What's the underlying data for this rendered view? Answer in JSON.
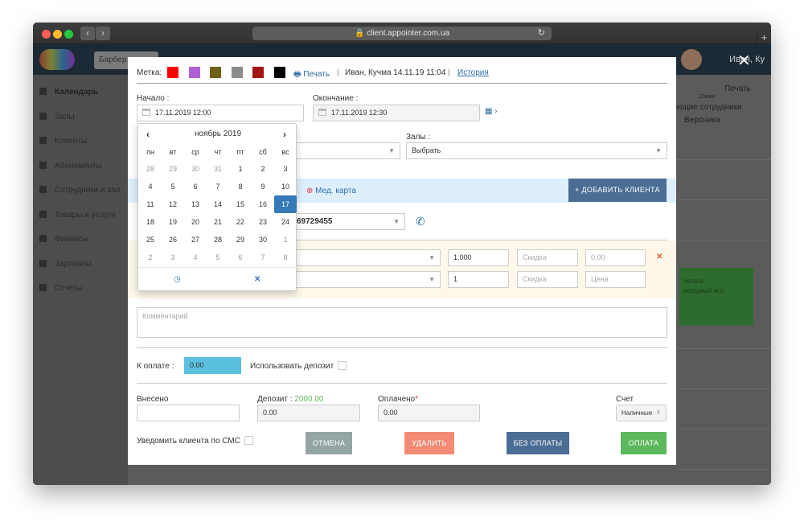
{
  "browser": {
    "url": "client.appointer.com.ua",
    "lock_icon": "lock-icon",
    "reload_icon": "↻",
    "new_tab_icon": "+"
  },
  "app": {
    "branch_label": "Барбер",
    "user_name": "Иван, Ку",
    "sidebar": [
      {
        "label": "Календарь",
        "active": true
      },
      {
        "label": "Залы"
      },
      {
        "label": "Клиенты"
      },
      {
        "label": "Абонементы"
      },
      {
        "label": "Сотрудники и зал"
      },
      {
        "label": "Товары и услуги"
      },
      {
        "label": "Финансы"
      },
      {
        "label": "Зарплаты"
      },
      {
        "label": "Отчеты"
      }
    ],
    "right_print": "Печать",
    "right_zoom": "20мин",
    "right_staff_label": "ющие сотрудники",
    "right_staff_name": "Вероника",
    "right_green_text1": "Чельга",
    "right_green_text2": "зарядный ясй"
  },
  "modal": {
    "label_tag": "Метка:",
    "tag_colors": [
      "#ff0000",
      "#b061d5",
      "#6e5f1a",
      "#8c8c8c",
      "#a31515",
      "#000000"
    ],
    "print_label": "Печать",
    "author_text": "Иван, Кучма 14.11.19 11:04",
    "history_label": "История",
    "start_label": "Начало :",
    "start_value": "17.11.2019 12:00",
    "end_label": "Окончание :",
    "end_value": "17.11.2019 12:30",
    "halls_label": "Залы :",
    "halls_value": "Выбрать",
    "med_card_label": "Мед. карта",
    "add_client_label": "ДОБАВИТЬ КЛИЕНТА",
    "phone_value": "69729455",
    "rows": [
      {
        "qty": "1.000",
        "discount_placeholder": "Скидка",
        "price": "0.00"
      },
      {
        "qty": "1",
        "discount_placeholder": "Скидка",
        "price_placeholder": "Цена"
      }
    ],
    "comment_placeholder": "Комментарий",
    "to_pay_label": "К оплате :",
    "to_pay_value": "0.00",
    "use_deposit_label": "Использовать депозит",
    "deposited_label": "Внесено",
    "deposit_label": "Депозит :",
    "deposit_amount": "2000.00",
    "paid_label": "Оплачено",
    "paid_required": "*",
    "deposit_field_value": "0.00",
    "paid_value": "0.00",
    "account_label": "Счет",
    "account_value": "Наличные",
    "notify_label": "Уведомить клиента по СМС",
    "buttons": {
      "cancel": "ОТМЕНА",
      "delete": "УДАЛИТЬ",
      "no_payment": "БЕЗ ОПЛАТЫ",
      "pay": "ОПЛАТА"
    }
  },
  "calendar": {
    "month_label": "ноябрь 2019",
    "weekdays": [
      "пн",
      "вт",
      "ср",
      "чт",
      "пт",
      "сб",
      "вс"
    ],
    "weeks": [
      [
        [
          "28",
          true
        ],
        [
          "29",
          true
        ],
        [
          "30",
          true
        ],
        [
          "31",
          true
        ],
        [
          "1",
          false
        ],
        [
          "2",
          false
        ],
        [
          "3",
          false
        ]
      ],
      [
        [
          "4",
          false
        ],
        [
          "5",
          false
        ],
        [
          "6",
          false
        ],
        [
          "7",
          false
        ],
        [
          "8",
          false
        ],
        [
          "9",
          false
        ],
        [
          "10",
          false
        ]
      ],
      [
        [
          "11",
          false
        ],
        [
          "12",
          false
        ],
        [
          "13",
          false
        ],
        [
          "14",
          false
        ],
        [
          "15",
          false
        ],
        [
          "16",
          false
        ],
        [
          "17",
          false
        ]
      ],
      [
        [
          "18",
          false
        ],
        [
          "19",
          false
        ],
        [
          "20",
          false
        ],
        [
          "21",
          false
        ],
        [
          "22",
          false
        ],
        [
          "23",
          false
        ],
        [
          "24",
          false
        ]
      ],
      [
        [
          "25",
          false
        ],
        [
          "26",
          false
        ],
        [
          "27",
          false
        ],
        [
          "28",
          false
        ],
        [
          "29",
          false
        ],
        [
          "30",
          false
        ],
        [
          "1",
          true
        ]
      ],
      [
        [
          "2",
          true
        ],
        [
          "3",
          true
        ],
        [
          "4",
          true
        ],
        [
          "5",
          true
        ],
        [
          "6",
          true
        ],
        [
          "7",
          true
        ],
        [
          "8",
          true
        ]
      ]
    ],
    "selected_day": "17",
    "colors": {
      "selected": "#337ab7"
    }
  },
  "colors": {
    "add_client": "#4a6d93",
    "cancel": "#95a5a6",
    "delete": "#f28b76",
    "no_payment": "#4a6d93",
    "pay": "#5cb85c",
    "to_pay_bg": "#5bc0de",
    "deposit_amount": "#5cb85c"
  }
}
